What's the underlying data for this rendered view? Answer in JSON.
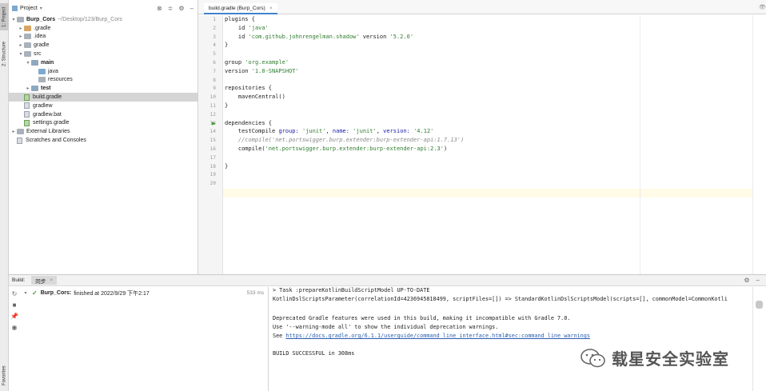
{
  "left_strip": {
    "tab_project": "1: Project",
    "tab_structure": "2: Structure",
    "tab_favorites": "Favorites"
  },
  "project_panel": {
    "title": "Project",
    "tree": [
      {
        "label": "Burp_Cors",
        "suffix": "~/Desktop/123/Burp_Cors",
        "indent": 0,
        "arrow": "open",
        "icon": "folder"
      },
      {
        "label": ".gradle",
        "indent": 1,
        "arrow": "closed",
        "icon": "folder-orange"
      },
      {
        "label": ".idea",
        "indent": 1,
        "arrow": "closed",
        "icon": "folder"
      },
      {
        "label": "gradle",
        "indent": 1,
        "arrow": "closed",
        "icon": "folder"
      },
      {
        "label": "src",
        "indent": 1,
        "arrow": "open",
        "icon": "folder"
      },
      {
        "label": "main",
        "indent": 2,
        "arrow": "open",
        "icon": "folder-src"
      },
      {
        "label": "java",
        "indent": 3,
        "arrow": "none",
        "icon": "folder-blue"
      },
      {
        "label": "resources",
        "indent": 3,
        "arrow": "none",
        "icon": "folder"
      },
      {
        "label": "test",
        "indent": 2,
        "arrow": "closed",
        "icon": "folder-src"
      },
      {
        "label": "build.gradle",
        "indent": 1,
        "arrow": "none",
        "icon": "file-gradle"
      },
      {
        "label": "gradlew",
        "indent": 1,
        "arrow": "none",
        "icon": "file"
      },
      {
        "label": "gradlew.bat",
        "indent": 1,
        "arrow": "none",
        "icon": "file"
      },
      {
        "label": "settings.gradle",
        "indent": 1,
        "arrow": "none",
        "icon": "file-gradle"
      },
      {
        "label": "External Libraries",
        "indent": 0,
        "arrow": "closed",
        "icon": "folder"
      },
      {
        "label": "Scratches and Consoles",
        "indent": 0,
        "arrow": "none",
        "icon": "file"
      }
    ]
  },
  "editor": {
    "tab_label": "build.gradle (Burp_Cors)",
    "line_numbers": [
      "1",
      "2",
      "3",
      "4",
      "5",
      "6",
      "7",
      "8",
      "9",
      "10",
      "11",
      "12",
      "13",
      "14",
      "15",
      "16",
      "17",
      "18",
      "19",
      "20"
    ],
    "lines": [
      "plugins {",
      "    id 'java'",
      "    id 'com.github.johnrengelman.shadow' version '5.2.0'",
      "}",
      "",
      "group 'org.example'",
      "version '1.0-SNAPSHOT'",
      "",
      "repositories {",
      "    mavenCentral()",
      "}",
      "",
      "dependencies {",
      "    testCompile group: 'junit', name: 'junit', version: '4.12'",
      "    //compile('net.portswigger.burp.extender:burp-extender-api:1.7.13')",
      "    compile('net.portswigger.burp.extender:burp-extender-api:2.3')",
      "",
      "}",
      "",
      ""
    ]
  },
  "build": {
    "label": "Build:",
    "tab_label": "同步",
    "run_name": "Burp_Cors:",
    "run_status": "finished at 2022/9/29 下午2:17",
    "run_time": "533 ms",
    "console": [
      "> Task :prepareKotlinBuildScriptModel UP-TO-DATE",
      "KotlinDslScriptsParameter(correlationId=4236945818499, scriptFiles=[]) => StandardKotlinDslScriptsModel(scripts=[], commonModel=CommonKotli",
      "",
      "Deprecated Gradle features were used in this build, making it incompatible with Gradle 7.0.",
      "Use '--warning-mode all' to show the individual deprecation warnings.",
      "See ",
      "",
      "BUILD SUCCESSFUL in 308ms"
    ],
    "link": "https://docs.gradle.org/6.1.1/userguide/command_line_interface.html#sec:command_line_warnings"
  },
  "watermark": {
    "text": "载星安全实验室"
  }
}
